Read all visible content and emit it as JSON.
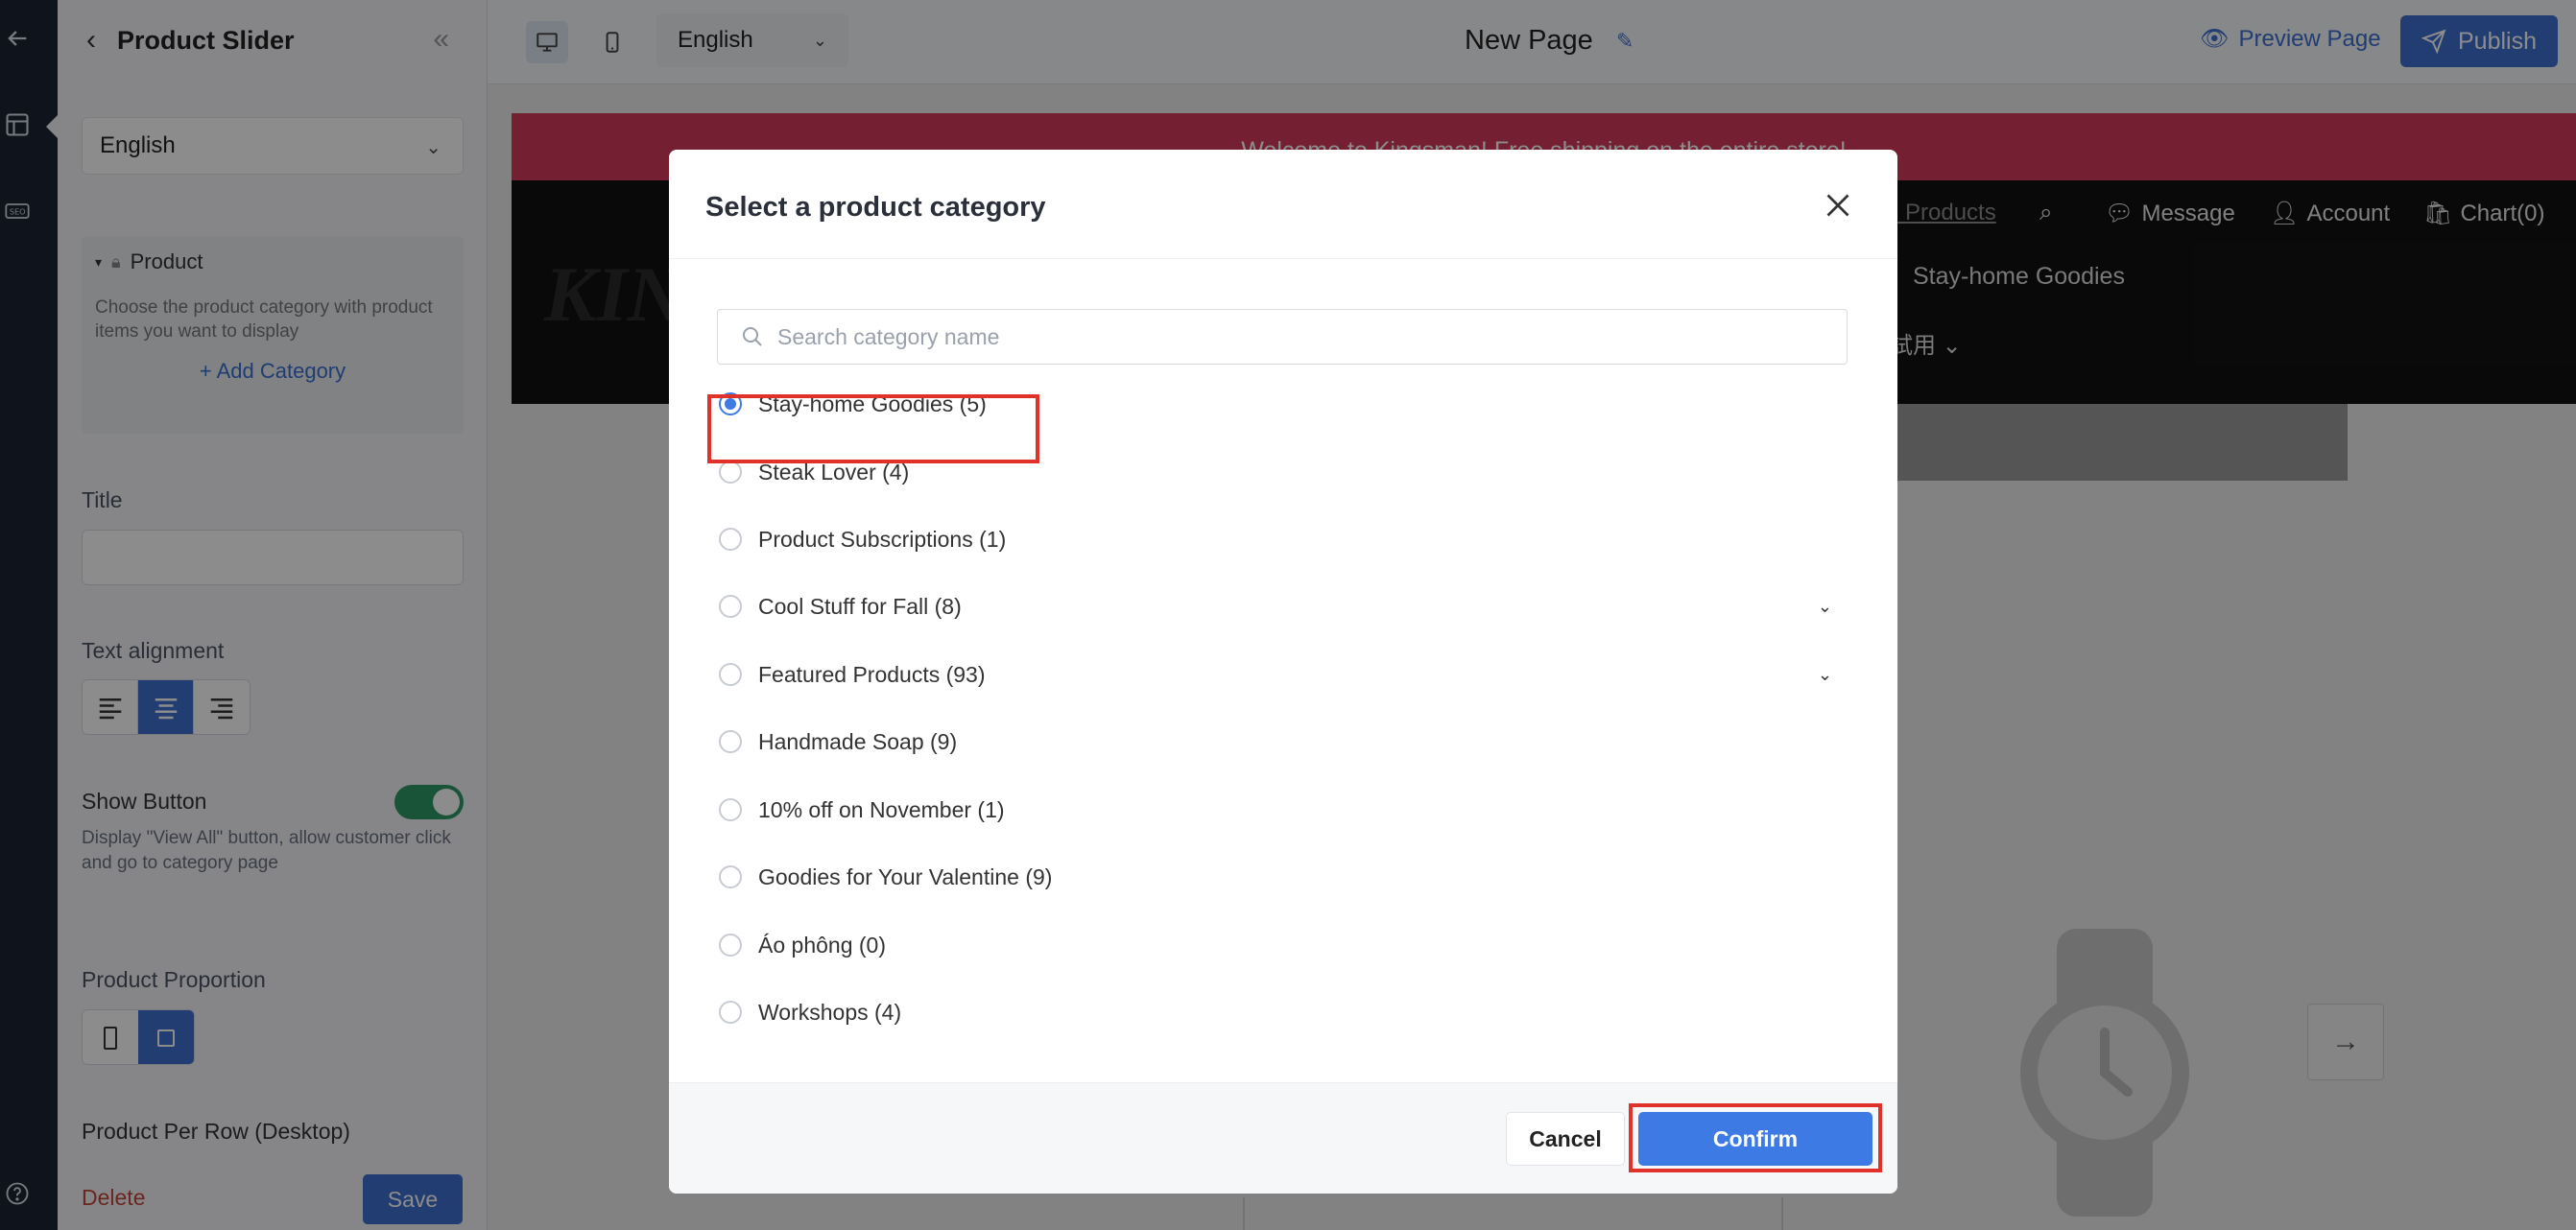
{
  "editor": {
    "panel_title": "Product Slider",
    "language": "English",
    "product_section": {
      "header": "Product",
      "description": "Choose the product category with product items you want to display",
      "add_category": "+ Add Category"
    },
    "title_label": "Title",
    "title_value": "",
    "text_alignment_label": "Text alignment",
    "show_button_label": "Show Button",
    "show_button_on": true,
    "show_button_desc": "Display \"View All\" button, allow customer click and go to category page",
    "product_proportion_label": "Product Proportion",
    "product_per_row_label": "Product Per Row (Desktop)",
    "delete_label": "Delete",
    "save_label": "Save"
  },
  "topbar": {
    "language": "English",
    "page_name": "New Page",
    "preview_label": "Preview Page",
    "publish_label": "Publish"
  },
  "store_preview": {
    "banner_text": "Welcome to Kingsman! Free shipping on the entire store!",
    "logo_text": "KIN",
    "search_text": "rch Products",
    "message": "Message",
    "account": "Account",
    "cart": "Chart(0)",
    "nav_category": "Stay-home Goodies",
    "nav_more": "試用"
  },
  "modal": {
    "title": "Select a product category",
    "search_placeholder": "Search category name",
    "categories": [
      {
        "label": "Stay-home Goodies (5)",
        "selected": true,
        "expandable": false
      },
      {
        "label": "Steak Lover (4)",
        "selected": false,
        "expandable": false
      },
      {
        "label": "Product Subscriptions (1)",
        "selected": false,
        "expandable": false
      },
      {
        "label": "Cool Stuff for Fall (8)",
        "selected": false,
        "expandable": true
      },
      {
        "label": "Featured Products (93)",
        "selected": false,
        "expandable": true
      },
      {
        "label": "Handmade Soap (9)",
        "selected": false,
        "expandable": false
      },
      {
        "label": "10% off on November (1)",
        "selected": false,
        "expandable": false
      },
      {
        "label": "Goodies for Your Valentine (9)",
        "selected": false,
        "expandable": false
      },
      {
        "label": "Áo phông (0)",
        "selected": false,
        "expandable": false
      },
      {
        "label": "Workshops (4)",
        "selected": false,
        "expandable": false
      }
    ],
    "cancel_label": "Cancel",
    "confirm_label": "Confirm"
  },
  "colors": {
    "accent": "#3d7ae3",
    "banner": "#d43a5b",
    "highlight": "#e0312a",
    "toggle_on": "#2e9a68"
  }
}
